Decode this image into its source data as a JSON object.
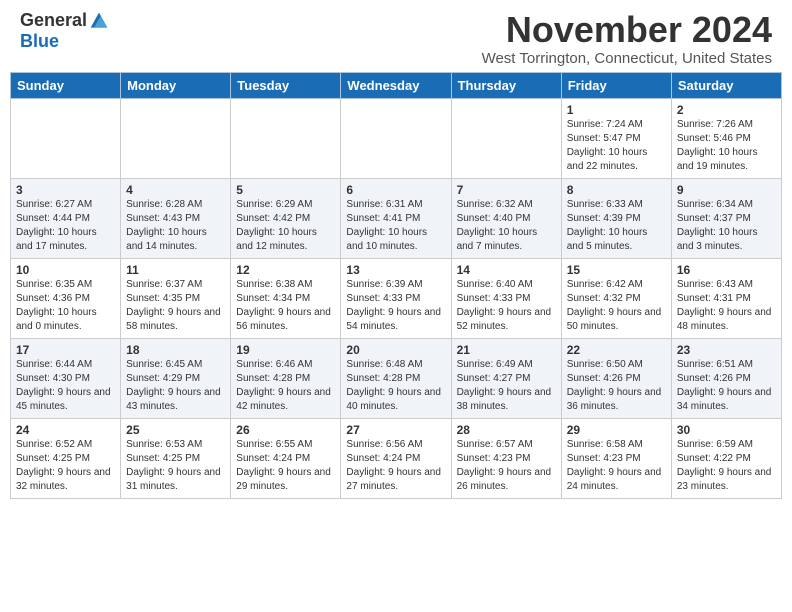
{
  "logo": {
    "general": "General",
    "blue": "Blue"
  },
  "header": {
    "month": "November 2024",
    "location": "West Torrington, Connecticut, United States"
  },
  "weekdays": [
    "Sunday",
    "Monday",
    "Tuesday",
    "Wednesday",
    "Thursday",
    "Friday",
    "Saturday"
  ],
  "weeks": [
    [
      {
        "day": "",
        "info": ""
      },
      {
        "day": "",
        "info": ""
      },
      {
        "day": "",
        "info": ""
      },
      {
        "day": "",
        "info": ""
      },
      {
        "day": "",
        "info": ""
      },
      {
        "day": "1",
        "info": "Sunrise: 7:24 AM\nSunset: 5:47 PM\nDaylight: 10 hours and 22 minutes."
      },
      {
        "day": "2",
        "info": "Sunrise: 7:26 AM\nSunset: 5:46 PM\nDaylight: 10 hours and 19 minutes."
      }
    ],
    [
      {
        "day": "3",
        "info": "Sunrise: 6:27 AM\nSunset: 4:44 PM\nDaylight: 10 hours and 17 minutes."
      },
      {
        "day": "4",
        "info": "Sunrise: 6:28 AM\nSunset: 4:43 PM\nDaylight: 10 hours and 14 minutes."
      },
      {
        "day": "5",
        "info": "Sunrise: 6:29 AM\nSunset: 4:42 PM\nDaylight: 10 hours and 12 minutes."
      },
      {
        "day": "6",
        "info": "Sunrise: 6:31 AM\nSunset: 4:41 PM\nDaylight: 10 hours and 10 minutes."
      },
      {
        "day": "7",
        "info": "Sunrise: 6:32 AM\nSunset: 4:40 PM\nDaylight: 10 hours and 7 minutes."
      },
      {
        "day": "8",
        "info": "Sunrise: 6:33 AM\nSunset: 4:39 PM\nDaylight: 10 hours and 5 minutes."
      },
      {
        "day": "9",
        "info": "Sunrise: 6:34 AM\nSunset: 4:37 PM\nDaylight: 10 hours and 3 minutes."
      }
    ],
    [
      {
        "day": "10",
        "info": "Sunrise: 6:35 AM\nSunset: 4:36 PM\nDaylight: 10 hours and 0 minutes."
      },
      {
        "day": "11",
        "info": "Sunrise: 6:37 AM\nSunset: 4:35 PM\nDaylight: 9 hours and 58 minutes."
      },
      {
        "day": "12",
        "info": "Sunrise: 6:38 AM\nSunset: 4:34 PM\nDaylight: 9 hours and 56 minutes."
      },
      {
        "day": "13",
        "info": "Sunrise: 6:39 AM\nSunset: 4:33 PM\nDaylight: 9 hours and 54 minutes."
      },
      {
        "day": "14",
        "info": "Sunrise: 6:40 AM\nSunset: 4:33 PM\nDaylight: 9 hours and 52 minutes."
      },
      {
        "day": "15",
        "info": "Sunrise: 6:42 AM\nSunset: 4:32 PM\nDaylight: 9 hours and 50 minutes."
      },
      {
        "day": "16",
        "info": "Sunrise: 6:43 AM\nSunset: 4:31 PM\nDaylight: 9 hours and 48 minutes."
      }
    ],
    [
      {
        "day": "17",
        "info": "Sunrise: 6:44 AM\nSunset: 4:30 PM\nDaylight: 9 hours and 45 minutes."
      },
      {
        "day": "18",
        "info": "Sunrise: 6:45 AM\nSunset: 4:29 PM\nDaylight: 9 hours and 43 minutes."
      },
      {
        "day": "19",
        "info": "Sunrise: 6:46 AM\nSunset: 4:28 PM\nDaylight: 9 hours and 42 minutes."
      },
      {
        "day": "20",
        "info": "Sunrise: 6:48 AM\nSunset: 4:28 PM\nDaylight: 9 hours and 40 minutes."
      },
      {
        "day": "21",
        "info": "Sunrise: 6:49 AM\nSunset: 4:27 PM\nDaylight: 9 hours and 38 minutes."
      },
      {
        "day": "22",
        "info": "Sunrise: 6:50 AM\nSunset: 4:26 PM\nDaylight: 9 hours and 36 minutes."
      },
      {
        "day": "23",
        "info": "Sunrise: 6:51 AM\nSunset: 4:26 PM\nDaylight: 9 hours and 34 minutes."
      }
    ],
    [
      {
        "day": "24",
        "info": "Sunrise: 6:52 AM\nSunset: 4:25 PM\nDaylight: 9 hours and 32 minutes."
      },
      {
        "day": "25",
        "info": "Sunrise: 6:53 AM\nSunset: 4:25 PM\nDaylight: 9 hours and 31 minutes."
      },
      {
        "day": "26",
        "info": "Sunrise: 6:55 AM\nSunset: 4:24 PM\nDaylight: 9 hours and 29 minutes."
      },
      {
        "day": "27",
        "info": "Sunrise: 6:56 AM\nSunset: 4:24 PM\nDaylight: 9 hours and 27 minutes."
      },
      {
        "day": "28",
        "info": "Sunrise: 6:57 AM\nSunset: 4:23 PM\nDaylight: 9 hours and 26 minutes."
      },
      {
        "day": "29",
        "info": "Sunrise: 6:58 AM\nSunset: 4:23 PM\nDaylight: 9 hours and 24 minutes."
      },
      {
        "day": "30",
        "info": "Sunrise: 6:59 AM\nSunset: 4:22 PM\nDaylight: 9 hours and 23 minutes."
      }
    ]
  ]
}
